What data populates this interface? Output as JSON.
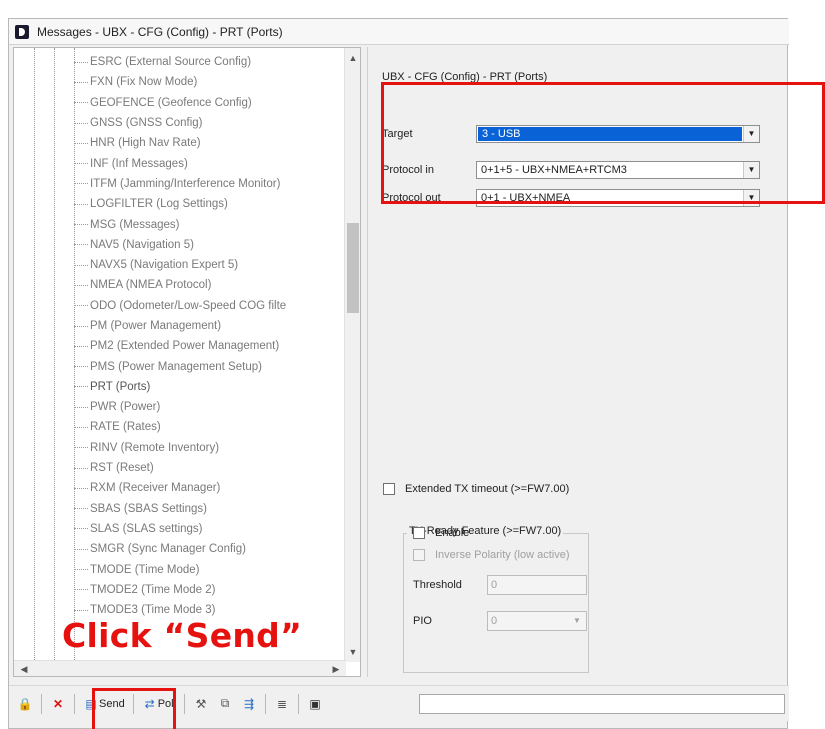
{
  "window": {
    "title": "Messages - UBX - CFG (Config) - PRT (Ports)"
  },
  "tree": {
    "items": [
      "ESRC (External Source Config)",
      "FXN (Fix Now Mode)",
      "GEOFENCE (Geofence Config)",
      "GNSS (GNSS Config)",
      "HNR (High Nav Rate)",
      "INF (Inf Messages)",
      "ITFM (Jamming/Interference Monitor)",
      "LOGFILTER (Log Settings)",
      "MSG (Messages)",
      "NAV5 (Navigation 5)",
      "NAVX5 (Navigation Expert 5)",
      "NMEA (NMEA Protocol)",
      "ODO (Odometer/Low-Speed COG filte",
      "PM (Power Management)",
      "PM2 (Extended Power Management)",
      "PMS (Power Management Setup)",
      "PRT (Ports)",
      "PWR (Power)",
      "RATE (Rates)",
      "RINV (Remote Inventory)",
      "RST (Reset)",
      "RXM (Receiver Manager)",
      "SBAS (SBAS Settings)",
      "SLAS (SLAS settings)",
      "SMGR (Sync Manager Config)",
      "TMODE (Time Mode)",
      "TMODE2 (Time Mode 2)",
      "TMODE3 (Time Mode 3)"
    ],
    "selected_index": 16
  },
  "panel": {
    "header": "UBX - CFG (Config) - PRT (Ports)",
    "target_label": "Target",
    "target_value": "3 - USB",
    "protocol_in_label": "Protocol in",
    "protocol_in_value": "0+1+5 - UBX+NMEA+RTCM3",
    "protocol_out_label": "Protocol out",
    "protocol_out_value": "0+1 - UBX+NMEA",
    "extended_tx_label": "Extended TX timeout (>=FW7.00)",
    "txready_legend": "TX-Ready Feature (>=FW7.00)",
    "enable_label": "Enable",
    "inverse_label": "Inverse Polarity (low active)",
    "threshold_label": "Threshold",
    "threshold_value": "0",
    "pio_label": "PIO",
    "pio_value": "0"
  },
  "toolbar": {
    "send_label": "Send",
    "poll_label": "Poll"
  },
  "annotation": {
    "callout_text": "Click “Send”",
    "color": "#e5120f"
  },
  "colors": {
    "selection": "#0a63d6",
    "accent": "#e5120f"
  }
}
